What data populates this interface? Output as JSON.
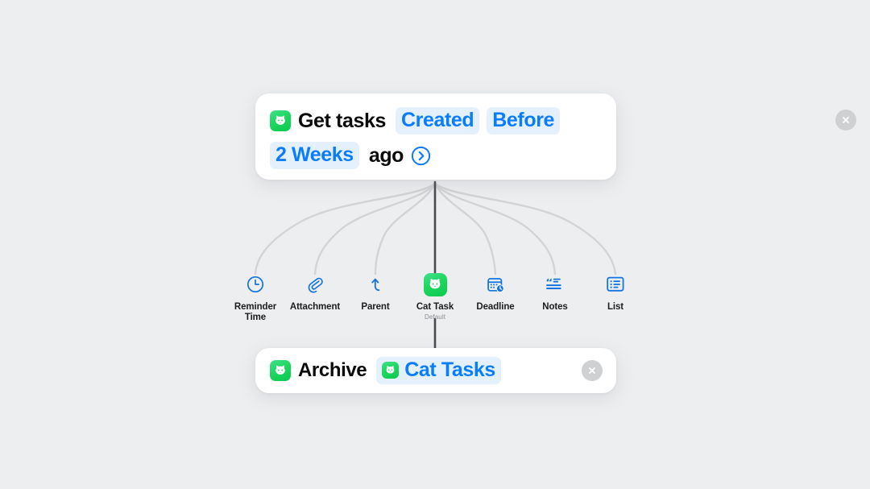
{
  "background_color": "#edeef0",
  "accent_blue": "#0a7cff",
  "token_bg": "#e4f1fd",
  "app_green": "#1ed760",
  "cards": [
    {
      "id": "get-tasks",
      "app_icon": "cat-app-icon",
      "close_icon": "close-icon",
      "lines": [
        {
          "parts": [
            {
              "kind": "text",
              "label": "Get tasks"
            },
            {
              "kind": "token",
              "label": "Created"
            },
            {
              "kind": "token",
              "label": "Before"
            }
          ]
        },
        {
          "parts": [
            {
              "kind": "token",
              "label": "2 Weeks"
            },
            {
              "kind": "text",
              "label": "ago"
            },
            {
              "kind": "chevron",
              "label": "chevron-right-circle-icon"
            }
          ]
        }
      ]
    },
    {
      "id": "archive",
      "app_icon": "cat-app-icon",
      "close_icon": "close-icon",
      "lines": [
        {
          "parts": [
            {
              "kind": "text",
              "label": "Archive"
            },
            {
              "kind": "token-app",
              "label": "Cat Tasks"
            }
          ]
        }
      ]
    }
  ],
  "card_texts": {
    "get_tasks_title": "Get tasks",
    "token_created": "Created",
    "token_before": "Before",
    "token_two_weeks": "2 Weeks",
    "text_ago": "ago",
    "archive_title": "Archive",
    "token_cat_tasks": "Cat Tasks"
  },
  "icon_row": {
    "items": [
      {
        "icon": "clock-icon",
        "label": "Reminder\nTime",
        "label_line1": "Reminder",
        "label_line2": "Time",
        "sublabel": "",
        "selected": false
      },
      {
        "icon": "paperclip-icon",
        "label": "Attachment",
        "sublabel": "",
        "selected": false
      },
      {
        "icon": "arrow-up-icon",
        "label": "Parent",
        "sublabel": "",
        "selected": false
      },
      {
        "icon": "cat-app-icon",
        "label": "Cat Task",
        "sublabel": "Default",
        "selected": true
      },
      {
        "icon": "calendar-clock-icon",
        "label": "Deadline",
        "sublabel": "",
        "selected": false
      },
      {
        "icon": "quote-notes-icon",
        "label": "Notes",
        "sublabel": "",
        "selected": false
      },
      {
        "icon": "list-icon",
        "label": "List",
        "sublabel": "",
        "selected": false
      }
    ]
  }
}
